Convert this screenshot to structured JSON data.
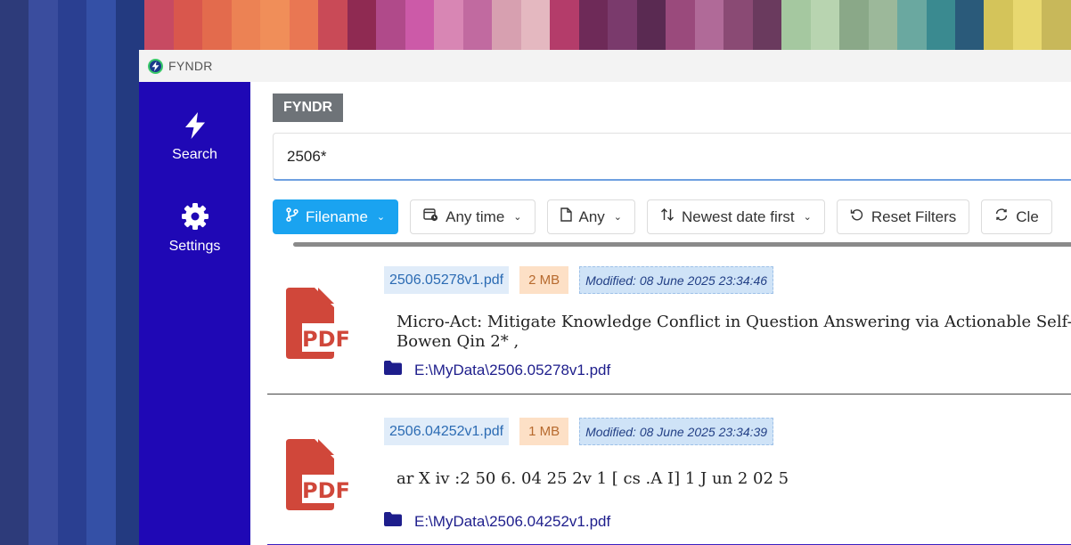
{
  "wallpaper": {
    "stripes": [
      "#2d3b7a",
      "#3a4d9e",
      "#2a3f91",
      "#3450a6",
      "#233a80",
      "#c74a62",
      "#d9574d",
      "#e36b4d",
      "#ec8254",
      "#f08e59",
      "#e97753",
      "#c94a57",
      "#8f2a52",
      "#b04a8a",
      "#cc5aa8",
      "#d886b4",
      "#c16aa0",
      "#d7a0b0",
      "#e4b8c0",
      "#b43c6a",
      "#6e2a58",
      "#7a3a6c",
      "#5a2a52",
      "#9a4a7c",
      "#b06a98",
      "#8a4a74",
      "#6a3a5e",
      "#a5c8a0",
      "#b8d4b0",
      "#8aa888",
      "#9cb89a",
      "#6aa8a0",
      "#3a8a90",
      "#2a5a7a",
      "#d4c45a",
      "#e8d870",
      "#c8b85a"
    ]
  },
  "window": {
    "title": "FYNDR",
    "accent": "#1f08b5"
  },
  "sidebar": {
    "items": [
      {
        "label": "Search",
        "icon": "lightning-icon"
      },
      {
        "label": "Settings",
        "icon": "gear-icon"
      }
    ]
  },
  "header": {
    "brand": "FYNDR"
  },
  "search": {
    "value": "2506*",
    "placeholder": ""
  },
  "filters": {
    "match_by": "Filename",
    "time": "Any time",
    "type": "Any",
    "sort": "Newest date first",
    "reset": "Reset Filters",
    "clear": "Cle"
  },
  "results": [
    {
      "filename": "2506.05278v1.pdf",
      "size": "2 MB",
      "modified": "Modified:  08 June 2025 23:34:46",
      "snippet_line1": "Micro-Act: Mitigate Knowledge Conflict in Question Answering via Actionable Self-R",
      "snippet_line2": "Bowen Qin 2* ,",
      "path": "E:\\MyData\\2506.05278v1.pdf"
    },
    {
      "filename": "2506.04252v1.pdf",
      "size": "1 MB",
      "modified": "Modified:  08 June 2025 23:34:39",
      "snippet_line1": "ar X iv :2 50 6. 04 25 2v 1 [ cs .A I] 1 J un 2 02 5",
      "snippet_line2": "",
      "path": "E:\\MyData\\2506.04252v1.pdf"
    }
  ]
}
